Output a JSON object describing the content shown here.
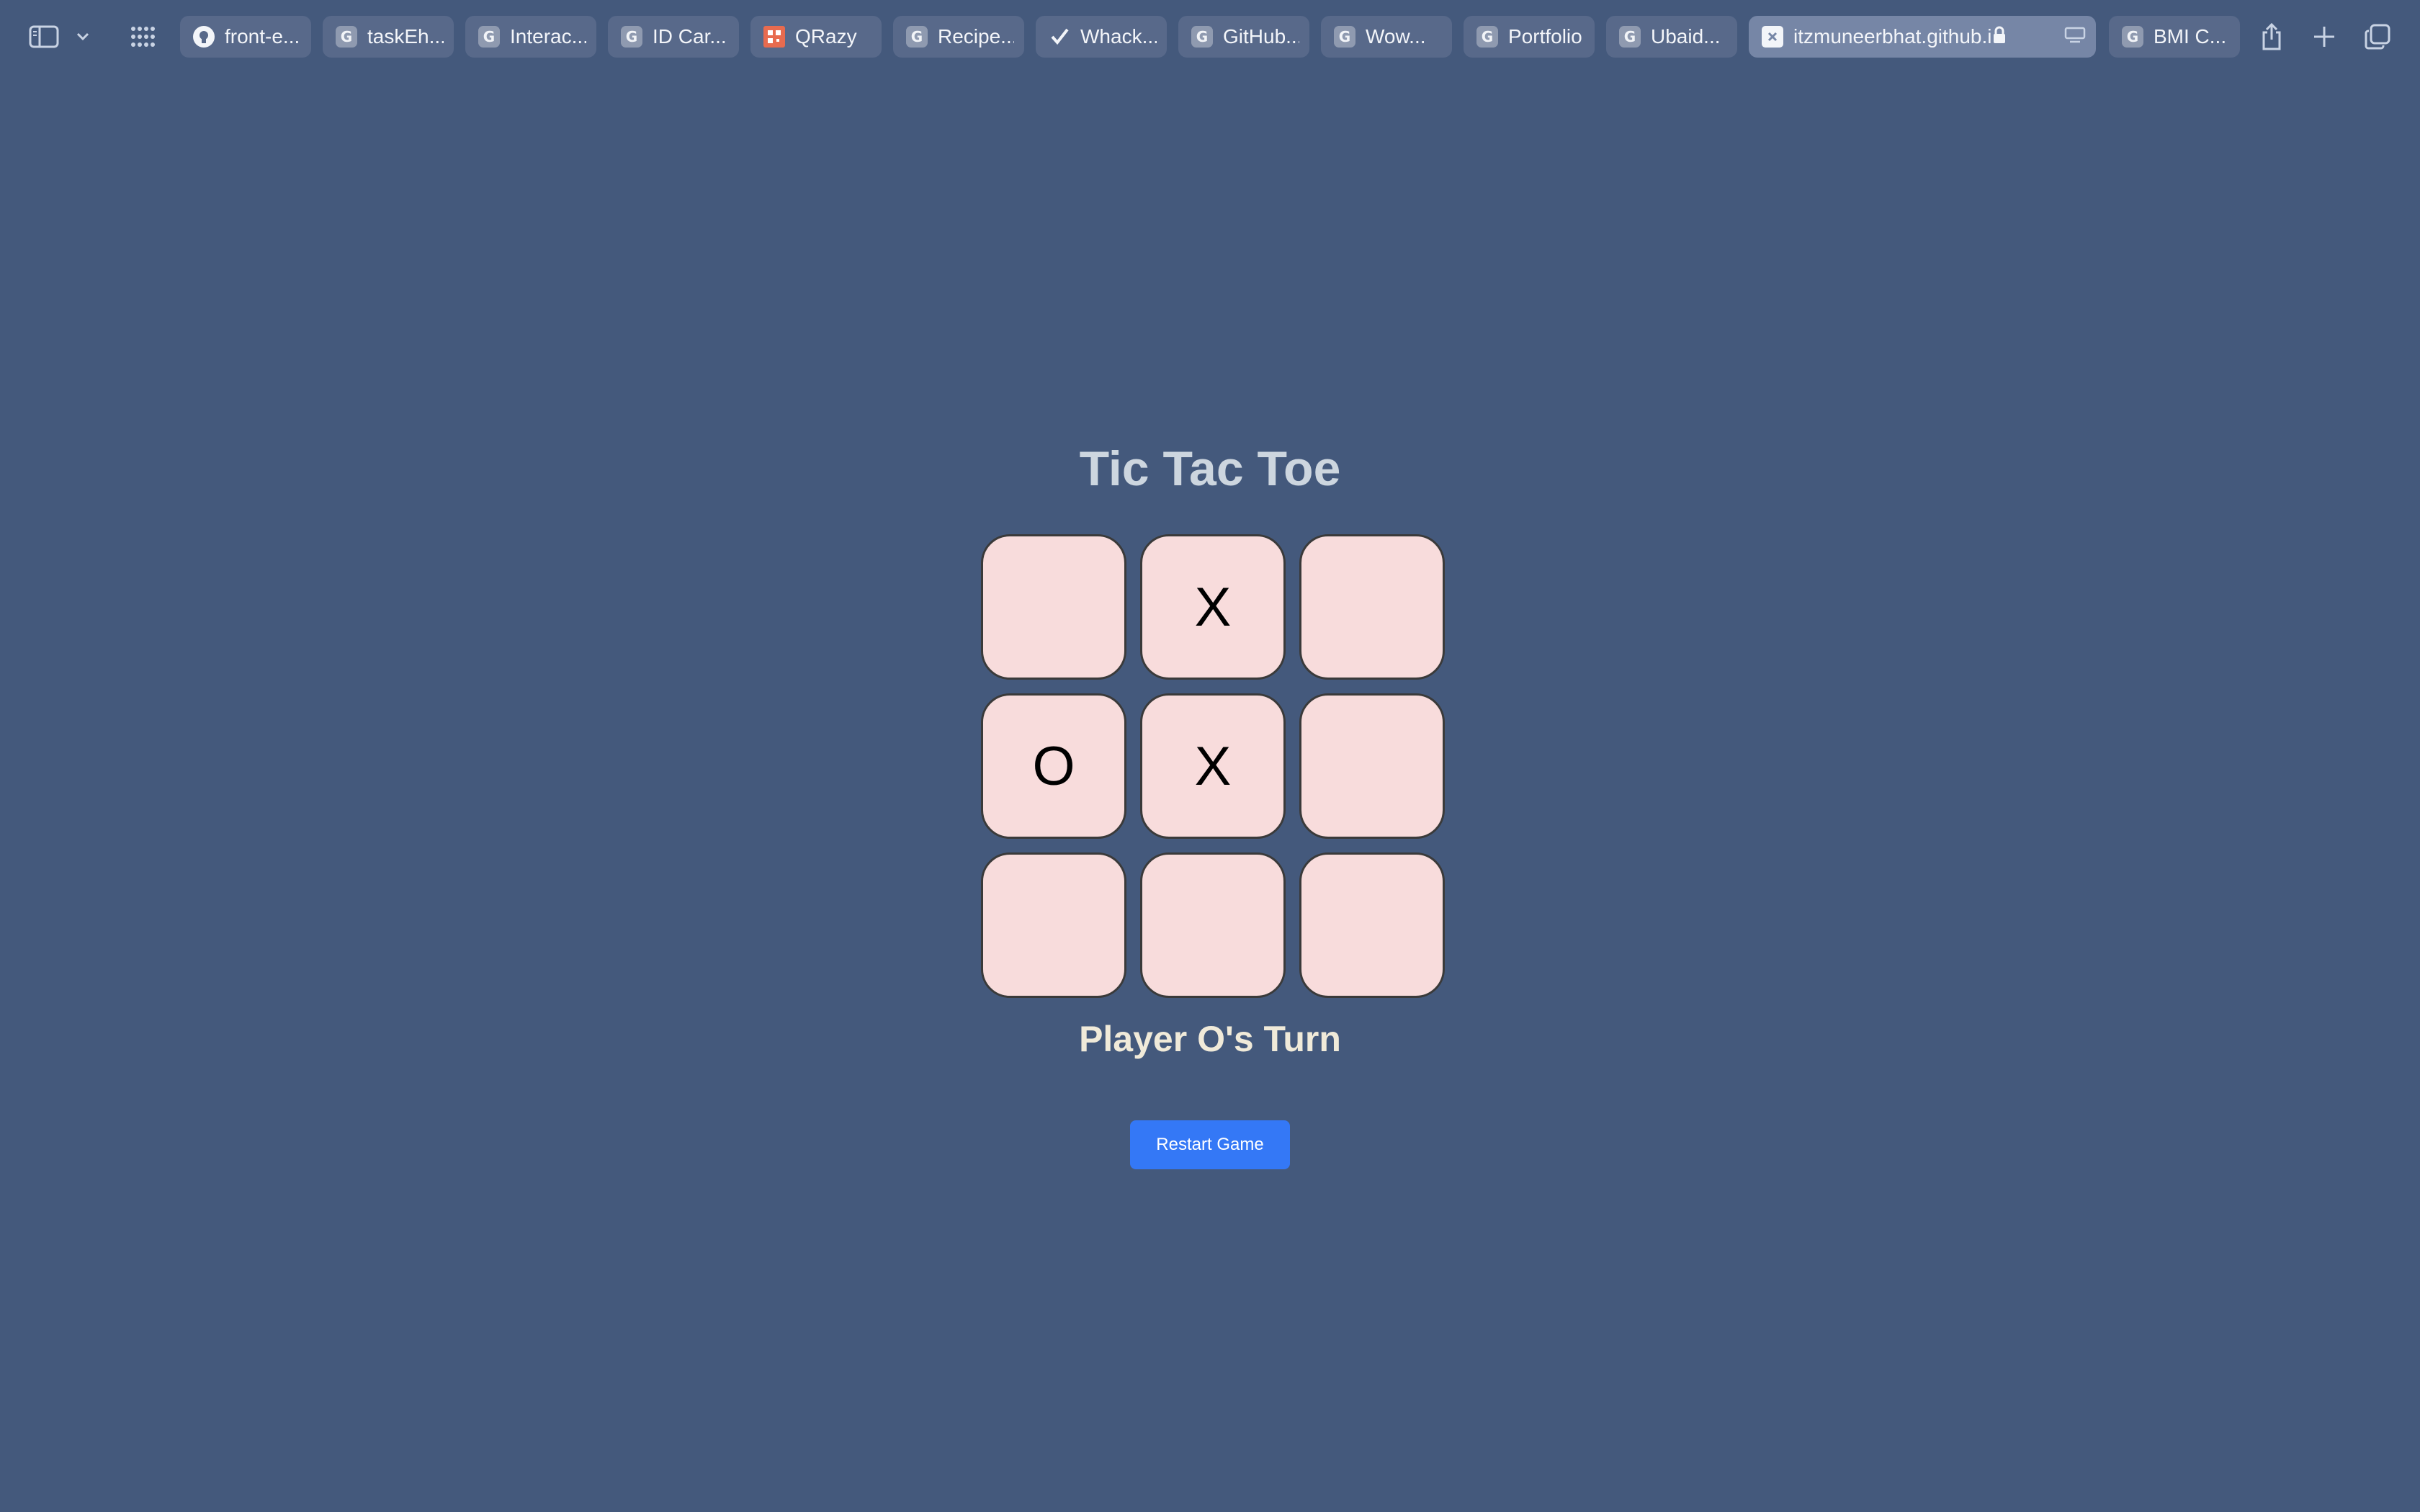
{
  "browser": {
    "tabs": [
      {
        "label": "front-e...",
        "icon": "github-icon"
      },
      {
        "label": "taskEh...",
        "icon": "g-icon"
      },
      {
        "label": "Interac...",
        "icon": "g-icon"
      },
      {
        "label": "ID Car...",
        "icon": "g-icon"
      },
      {
        "label": "QRazy",
        "icon": "qr-icon"
      },
      {
        "label": "Recipe...",
        "icon": "g-icon"
      },
      {
        "label": "Whack...",
        "icon": "checkmark-icon"
      },
      {
        "label": "GitHub...",
        "icon": "g-icon"
      },
      {
        "label": "Wow...",
        "icon": "g-icon"
      },
      {
        "label": "Portfolio",
        "icon": "g-icon"
      },
      {
        "label": "Ubaid...",
        "icon": "g-icon"
      },
      {
        "label": "itzmuneerbhat.github.io",
        "icon": "x-icon",
        "active": true
      },
      {
        "label": "BMI C...",
        "icon": "g-icon"
      }
    ]
  },
  "game": {
    "title": "Tic Tac Toe",
    "cells": [
      "",
      "X",
      "",
      "O",
      "X",
      "",
      "",
      "",
      ""
    ],
    "status": "Player O's Turn",
    "restart_label": "Restart Game"
  },
  "colors": {
    "background": "#44597c",
    "cell": "#f8dcdc",
    "button": "#3478f6",
    "title": "#cdd6df",
    "status": "#f0ead9"
  }
}
